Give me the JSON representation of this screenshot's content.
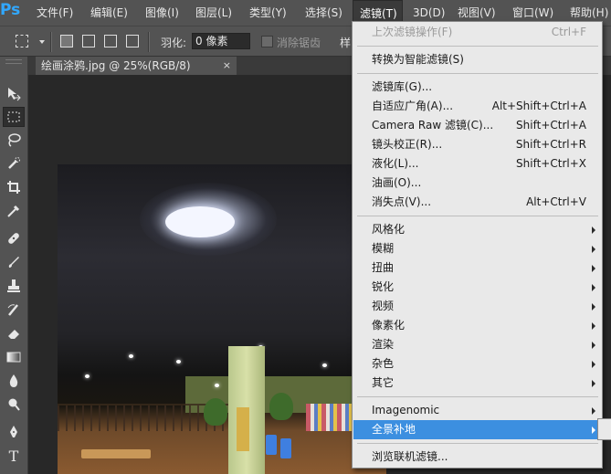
{
  "app": {
    "logo": "Ps"
  },
  "menubar": {
    "items": [
      "文件(F)",
      "编辑(E)",
      "图像(I)",
      "图层(L)",
      "类型(Y)",
      "选择(S)",
      "滤镜(T)",
      "3D(D)",
      "视图(V)",
      "窗口(W)",
      "帮助(H)"
    ],
    "active_index": 6
  },
  "options": {
    "feather_label": "羽化:",
    "feather_value": "0 像素",
    "antialias_label": "消除锯齿",
    "antialias_checked": false,
    "style_label": "样"
  },
  "document": {
    "tab_title": "绘画涂鸦.jpg @ 25%(RGB/8)",
    "close_glyph": "×"
  },
  "filter_menu": {
    "items": [
      {
        "label": "上次滤镜操作(F)",
        "shortcut": "Ctrl+F",
        "disabled": true
      },
      {
        "label": "转换为智能滤镜(S)",
        "shortcut": ""
      },
      {
        "label": "滤镜库(G)...",
        "shortcut": ""
      },
      {
        "label": "自适应广角(A)...",
        "shortcut": "Alt+Shift+Ctrl+A"
      },
      {
        "label": "Camera Raw 滤镜(C)...",
        "shortcut": "Shift+Ctrl+A"
      },
      {
        "label": "镜头校正(R)...",
        "shortcut": "Shift+Ctrl+R"
      },
      {
        "label": "液化(L)...",
        "shortcut": "Shift+Ctrl+X"
      },
      {
        "label": "油画(O)...",
        "shortcut": ""
      },
      {
        "label": "消失点(V)...",
        "shortcut": "Alt+Ctrl+V"
      },
      {
        "label": "风格化",
        "submenu": true
      },
      {
        "label": "模糊",
        "submenu": true
      },
      {
        "label": "扭曲",
        "submenu": true
      },
      {
        "label": "锐化",
        "submenu": true
      },
      {
        "label": "视频",
        "submenu": true
      },
      {
        "label": "像素化",
        "submenu": true
      },
      {
        "label": "渲染",
        "submenu": true
      },
      {
        "label": "杂色",
        "submenu": true
      },
      {
        "label": "其它",
        "submenu": true
      },
      {
        "label": "Imagenomic",
        "submenu": true
      },
      {
        "label": "全景补地",
        "submenu": true,
        "highlighted": true
      },
      {
        "label": "浏览联机滤镜...",
        "shortcut": ""
      }
    ]
  },
  "tools": [
    "move-tool",
    "marquee-tool",
    "lasso-tool",
    "quick-selection-tool",
    "crop-tool",
    "eyedropper-tool",
    "healing-brush-tool",
    "brush-tool",
    "clone-stamp-tool",
    "history-brush-tool",
    "eraser-tool",
    "gradient-tool",
    "blur-tool",
    "dodge-tool",
    "pen-tool",
    "type-tool"
  ],
  "colors": {
    "menu_highlight": "#3c8fe0",
    "ps_blue": "#31a8ff",
    "panel": "#535353"
  }
}
